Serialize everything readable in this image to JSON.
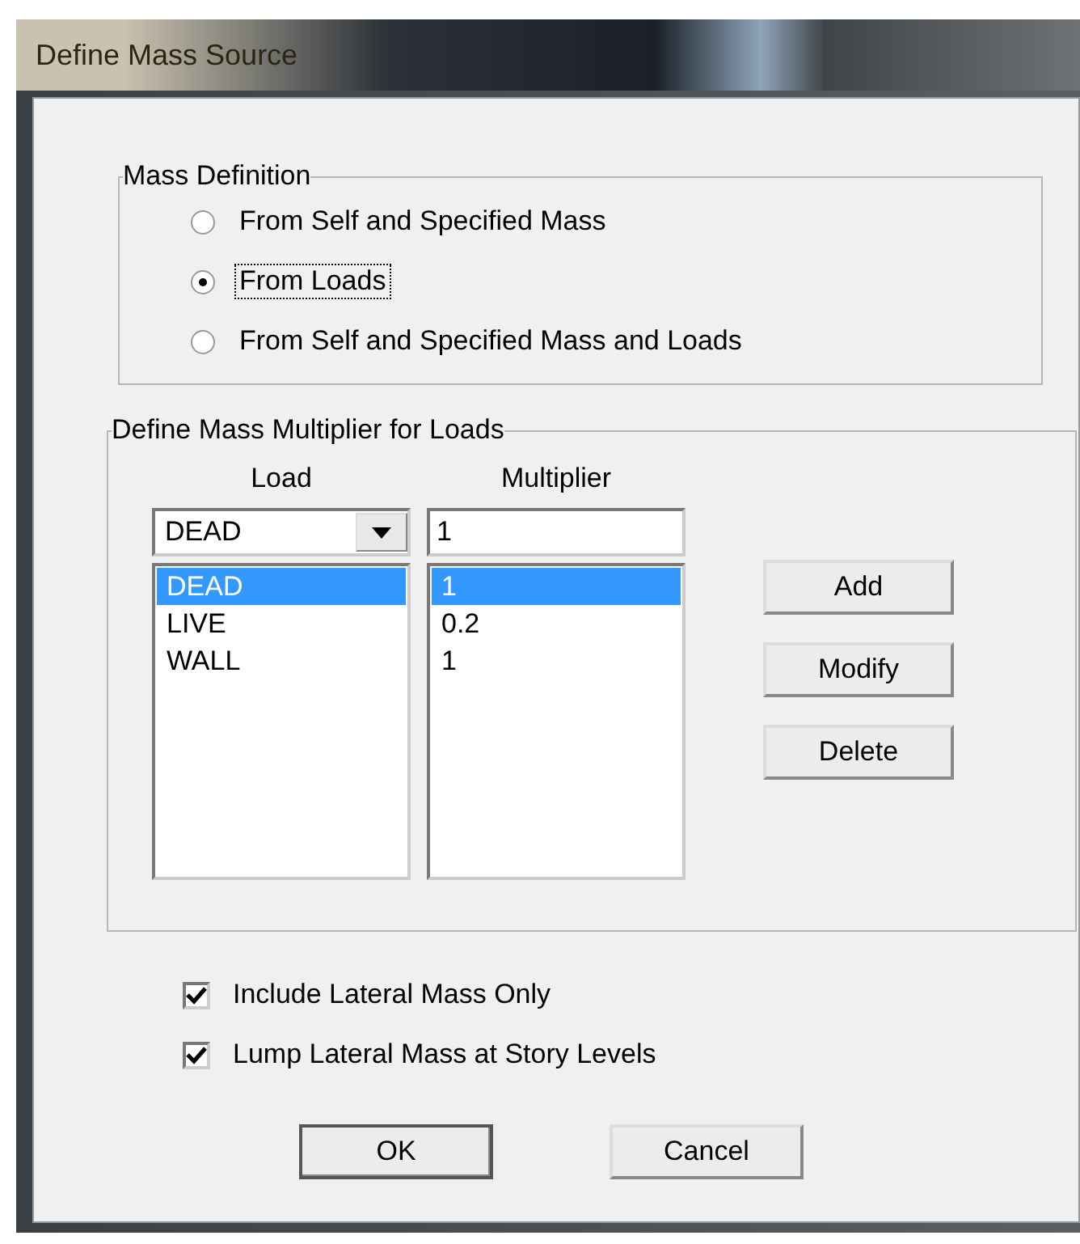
{
  "window": {
    "title": "Define Mass Source"
  },
  "mass_definition": {
    "title": "Mass Definition",
    "options": [
      {
        "label": "From Self and Specified Mass",
        "selected": false
      },
      {
        "label": "From Loads",
        "selected": true
      },
      {
        "label": "From Self and Specified Mass and Loads",
        "selected": false
      }
    ]
  },
  "multipliers": {
    "title": "Define Mass Multiplier for Loads",
    "load_header": "Load",
    "multiplier_header": "Multiplier",
    "load_combo": {
      "value": "DEAD"
    },
    "multiplier_field": {
      "value": "1"
    },
    "rows": [
      {
        "load": "DEAD",
        "multiplier": "1",
        "selected": true
      },
      {
        "load": "LIVE",
        "multiplier": "0.2",
        "selected": false
      },
      {
        "load": "WALL",
        "multiplier": "1",
        "selected": false
      }
    ],
    "buttons": [
      "Add",
      "Modify",
      "Delete"
    ]
  },
  "options": [
    {
      "label": "Include Lateral Mass Only",
      "checked": true
    },
    {
      "label": "Lump Lateral Mass at Story Levels",
      "checked": true
    }
  ],
  "buttons": [
    "OK",
    "Cancel"
  ]
}
